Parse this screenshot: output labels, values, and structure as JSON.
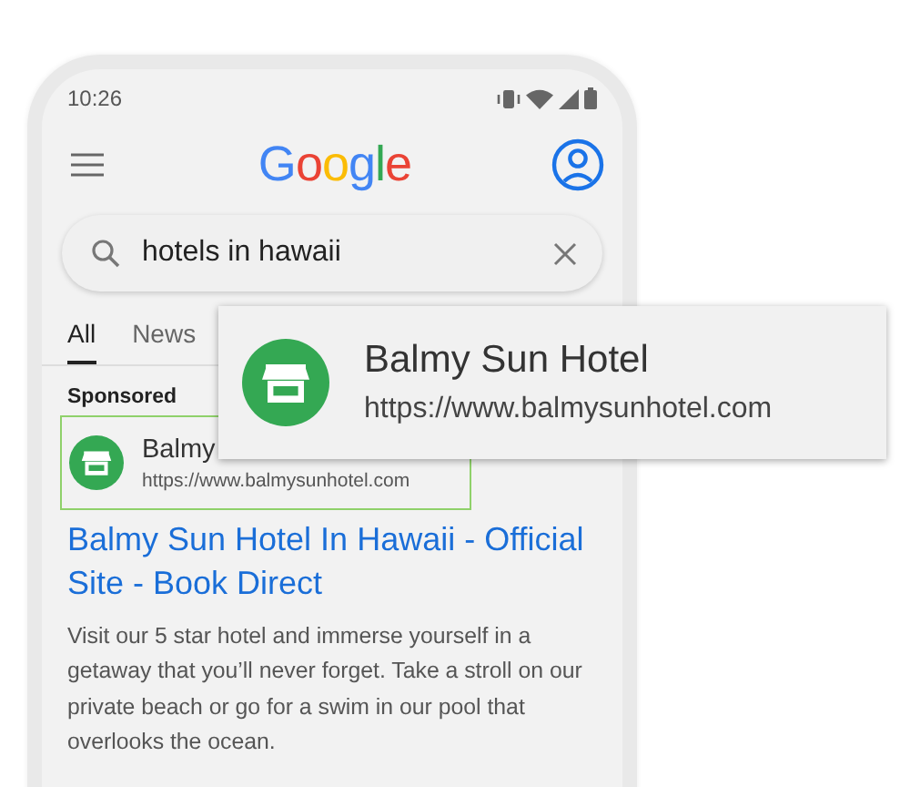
{
  "status_bar": {
    "time": "10:26"
  },
  "header": {
    "logo": "Google"
  },
  "search": {
    "value": "hotels in hawaii"
  },
  "tabs": [
    {
      "label": "All",
      "selected": true
    },
    {
      "label": "News",
      "selected": false
    }
  ],
  "ad": {
    "label": "Sponsored",
    "advertiser": "Balmy",
    "url": "https://www.balmysunhotel.com",
    "title": "Balmy Sun Hotel In Hawaii - Official Site - Book Direct",
    "description": "Visit our 5 star hotel and immerse yourself in a getaway that you’ll never forget. Take a stroll on our private beach or go for a swim in our pool that overlooks the ocean."
  },
  "callout": {
    "name": "Balmy Sun Hotel",
    "url": "https://www.balmysunhotel.com"
  }
}
